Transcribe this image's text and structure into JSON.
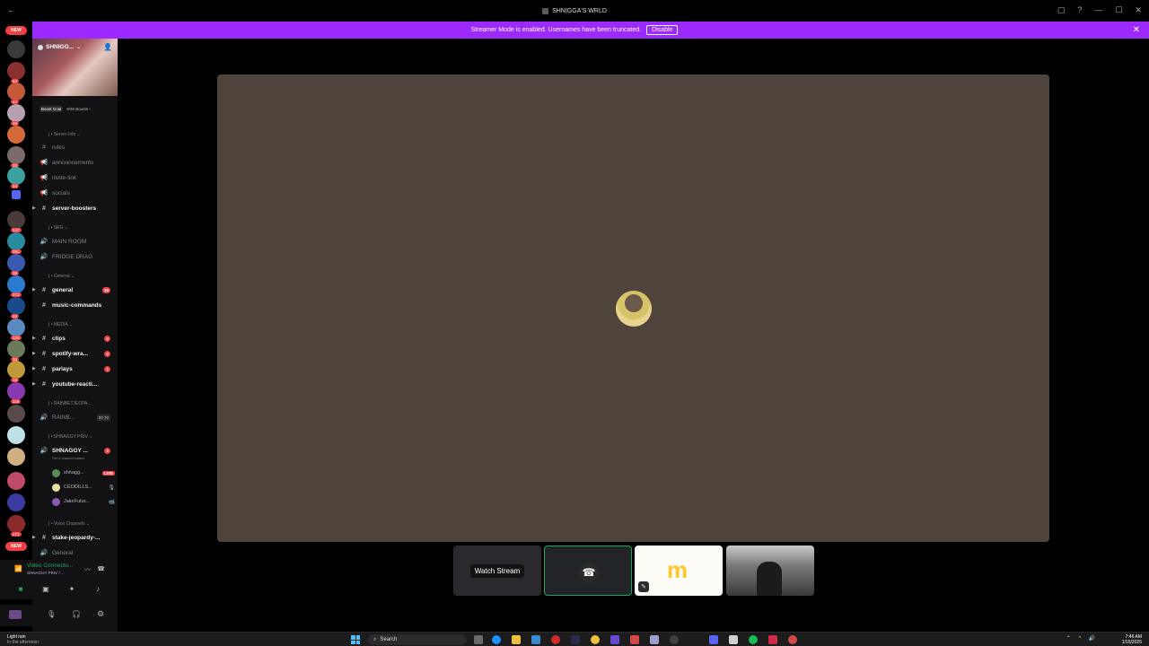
{
  "titlebar": {
    "title": "SHNIGGA'S WRLD",
    "back_arrow": "←",
    "win_controls": [
      "▢",
      "?",
      "—",
      "☐",
      "✕"
    ]
  },
  "banner": {
    "text": "Streamer Mode is enabled. Usernames have been truncated.",
    "button": "Disable",
    "close": "✕"
  },
  "guild_badges": {
    "new": "NEW",
    "items": [
      "6",
      "62",
      "47",
      "16",
      "",
      "20",
      "34",
      "",
      "147",
      "391",
      "36",
      "273",
      "46",
      "226",
      "16",
      "16",
      "116",
      "",
      "",
      "",
      "",
      "",
      "271"
    ],
    "new_bottom": "NEW"
  },
  "server": {
    "name": "SHNIGG...",
    "chevron": "⌄",
    "boost_goal": "Boost Goal",
    "boost_count": "9/36 Boosts ›"
  },
  "sidebar": {
    "categories": {
      "server_info": "Server Info",
      "seg": "SEG",
      "general": "General",
      "media": "MEDIA",
      "rainbet": "RAINBETJEOPA...",
      "priv": "SHNAGGY PRIV",
      "voice": "Voice Channels"
    },
    "channels": {
      "rules": "rules",
      "announcements": "announcements",
      "invite_link": "invite-link",
      "socials": "socials",
      "server_boosters": "server-boosters",
      "main_room": "MAIN ROOM",
      "fridge_drag": "FRIDGE DRAG",
      "general": "general",
      "general_count": "39",
      "music_commands": "music-commands",
      "clips": "clips",
      "clips_count": "2",
      "spotify": "spotify-wra...",
      "spotify_count": "2",
      "parlays": "parlays",
      "parlays_count": "1",
      "youtube": "youtube-reacti...",
      "rainb": "RAINB...",
      "rainb_count": "00 70",
      "shnaggy": "SHNAGGY ...",
      "shnaggy_count": "1",
      "shnaggy_status": "Set a channel status",
      "stake": "stake-jeopardy-...",
      "general_voice": "General"
    },
    "vc_users": [
      {
        "name": "shnagg...",
        "tag": "LIVE"
      },
      {
        "name": "CEODILLS...",
        "tag": ""
      },
      {
        "name": "JakeFutur...",
        "tag": ""
      }
    ]
  },
  "voice": {
    "status": "Video Connecte...",
    "channel": "SHNAGGY PRIV / ..."
  },
  "stage": {
    "watch_label": "Watch Stream"
  },
  "taskbar": {
    "weather_line1": "Light rain",
    "weather_line2": "In the afternoon",
    "search": "Search",
    "time": "7:46 AM",
    "date": "1/15/2025"
  },
  "colors": {
    "accent": "#9c2aff",
    "stage_bg": "#4f443b",
    "live": "#f23f43",
    "online": "#23a55a"
  }
}
